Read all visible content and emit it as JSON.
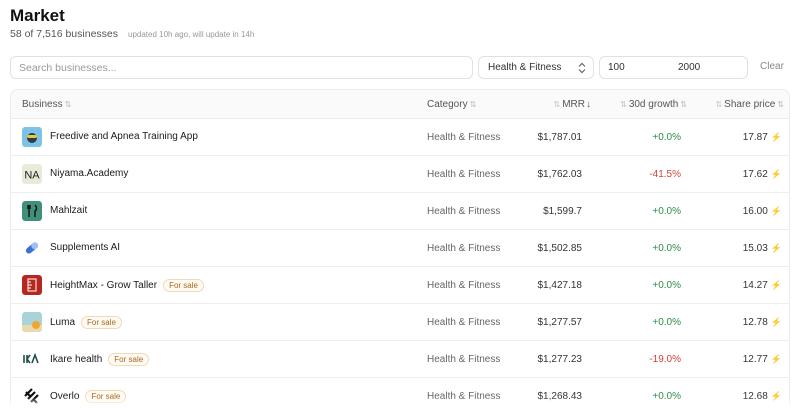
{
  "header": {
    "title": "Market",
    "count": "58 of 7,516 businesses",
    "updated": "updated 10h ago, will update in 14h"
  },
  "filters": {
    "search_placeholder": "Search businesses...",
    "category": "Health & Fitness",
    "min": "100",
    "max": "2000",
    "clear_label": "Clear"
  },
  "table": {
    "columns": {
      "business": "Business",
      "category": "Category",
      "mrr": "MRR",
      "growth": "30d growth",
      "price": "Share price"
    },
    "rows": [
      {
        "name": "Freedive and Apnea Training App",
        "badge": "",
        "category": "Health & Fitness",
        "mrr": "$1,787.01",
        "growth": "+0.0%",
        "price": "17.87",
        "logo_icon": "freedive-logo-icon",
        "trend": "positive"
      },
      {
        "name": "Niyama.Academy",
        "badge": "",
        "category": "Health & Fitness",
        "mrr": "$1,762.03",
        "growth": "-41.5%",
        "price": "17.62",
        "logo_icon": "niyama-logo-icon",
        "trend": "negative"
      },
      {
        "name": "Mahlzait",
        "badge": "",
        "category": "Health & Fitness",
        "mrr": "$1,599.7",
        "growth": "+0.0%",
        "price": "16.00",
        "logo_icon": "mahlzait-logo-icon",
        "trend": "positive"
      },
      {
        "name": "Supplements AI",
        "badge": "",
        "category": "Health & Fitness",
        "mrr": "$1,502.85",
        "growth": "+0.0%",
        "price": "15.03",
        "logo_icon": "pill-logo-icon",
        "trend": "positive"
      },
      {
        "name": "HeightMax - Grow Taller",
        "badge": "For sale",
        "category": "Health & Fitness",
        "mrr": "$1,427.18",
        "growth": "+0.0%",
        "price": "14.27",
        "logo_icon": "heightmax-logo-icon",
        "trend": "positive"
      },
      {
        "name": "Luma",
        "badge": "For sale",
        "category": "Health & Fitness",
        "mrr": "$1,277.57",
        "growth": "+0.0%",
        "price": "12.78",
        "logo_icon": "luma-logo-icon",
        "trend": "positive"
      },
      {
        "name": "Ikare health",
        "badge": "For sale",
        "category": "Health & Fitness",
        "mrr": "$1,277.23",
        "growth": "-19.0%",
        "price": "12.77",
        "logo_icon": "ikare-logo-icon",
        "trend": "negative"
      },
      {
        "name": "Overlo",
        "badge": "For sale",
        "category": "Health & Fitness",
        "mrr": "$1,268.43",
        "growth": "+0.0%",
        "price": "12.68",
        "logo_icon": "overlo-logo-icon",
        "trend": "positive"
      }
    ]
  },
  "colors": {
    "positive": "#2e8b46",
    "negative": "#d0433c",
    "badge": "#a86a1a",
    "bolt": "#f0b63a"
  }
}
